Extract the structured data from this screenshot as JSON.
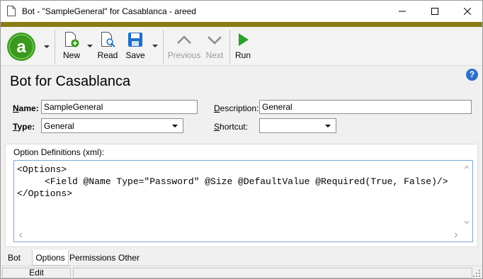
{
  "window": {
    "title": "Bot - \"SampleGeneral\" for Casablanca - areed"
  },
  "toolbar": {
    "new_label": "New",
    "read_label": "Read",
    "save_label": "Save",
    "previous_label": "Previous",
    "next_label": "Next",
    "run_label": "Run",
    "previous_enabled": false,
    "next_enabled": false
  },
  "form": {
    "title": "Bot for Casablanca",
    "name_label_u": "N",
    "name_label_rest": "ame:",
    "name_value": "SampleGeneral",
    "type_label_u": "T",
    "type_label_rest": "ype:",
    "type_value": "General",
    "description_label_u": "D",
    "description_label_rest": "escription:",
    "description_value": "General",
    "shortcut_label_u": "S",
    "shortcut_label_rest": "hortcut:",
    "shortcut_value": "",
    "options_group_label": "Option Definitions (xml):",
    "options_xml_lines": [
      "<Options>",
      "     <Field @Name Type=\"Password\" @Size @DefaultValue @Required(True, False)/>",
      "</Options>"
    ]
  },
  "tabs": {
    "items": [
      "Bot",
      "Options",
      "Permissions",
      "Other"
    ],
    "active": "Options"
  },
  "status": {
    "mode": "Edit"
  },
  "colors": {
    "accent_bar": "#8a7c14",
    "logo_green": "#3a9a1e",
    "run_green": "#2e9e2e",
    "save_blue": "#1f6fc9",
    "help_blue": "#2f6fc9"
  },
  "icons": [
    "document-icon",
    "minimize-icon",
    "maximize-icon",
    "close-icon",
    "app-logo-icon",
    "new-icon",
    "read-icon",
    "save-icon",
    "previous-icon",
    "next-icon",
    "run-icon",
    "help-icon",
    "dropdown-arrow-icon",
    "resize-grip-icon"
  ]
}
